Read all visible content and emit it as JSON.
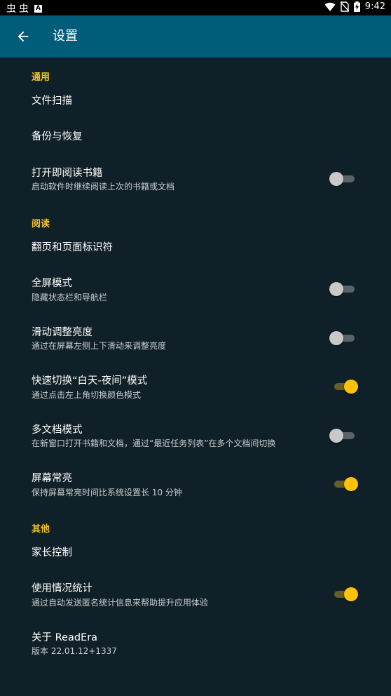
{
  "status_bar": {
    "left_glyph_1": "⾍",
    "left_glyph_2": "⾍",
    "left_box": "A",
    "time": "9:42"
  },
  "app_bar": {
    "title": "设置",
    "back_icon": "arrow-left-icon"
  },
  "sections": {
    "general": {
      "header": "通用",
      "file_scan": {
        "title": "文件扫描"
      },
      "backup": {
        "title": "备份与恢复"
      },
      "open_reading": {
        "title": "打开即阅读书籍",
        "summary": "启动软件时继续阅读上次的书籍或文档",
        "checked": false
      }
    },
    "reading": {
      "header": "阅读",
      "page_turn": {
        "title": "翻页和页面标识符"
      },
      "fullscreen": {
        "title": "全屏模式",
        "summary": "隐藏状态栏和导航栏",
        "checked": false
      },
      "brightness": {
        "title": "滑动调整亮度",
        "summary": "通过在屏幕左侧上下滑动来调整亮度",
        "checked": false
      },
      "day_night": {
        "title": "快速切换“白天-夜间”模式",
        "summary": "通过点击左上角切换颜色模式",
        "checked": true
      },
      "multi_doc": {
        "title": "多文档模式",
        "summary": "在新窗口打开书籍和文档，通过“最近任务列表”在多个文档间切换",
        "checked": false
      },
      "screen_on": {
        "title": "屏幕常亮",
        "summary": "保持屏幕常亮时间比系统设置长 10 分钟",
        "checked": true
      }
    },
    "other": {
      "header": "其他",
      "parental": {
        "title": "家长控制"
      },
      "stats": {
        "title": "使用情况统计",
        "summary": "通过自动发送匿名统计信息来帮助提升应用体验",
        "checked": true
      },
      "about": {
        "title": "关于 ReadEra",
        "summary": "版本 22.01.12+1337"
      }
    }
  },
  "colors": {
    "background": "#102028",
    "app_bar": "#005d7a",
    "accent": "#f5c023",
    "switch_on": "#ffc107"
  }
}
